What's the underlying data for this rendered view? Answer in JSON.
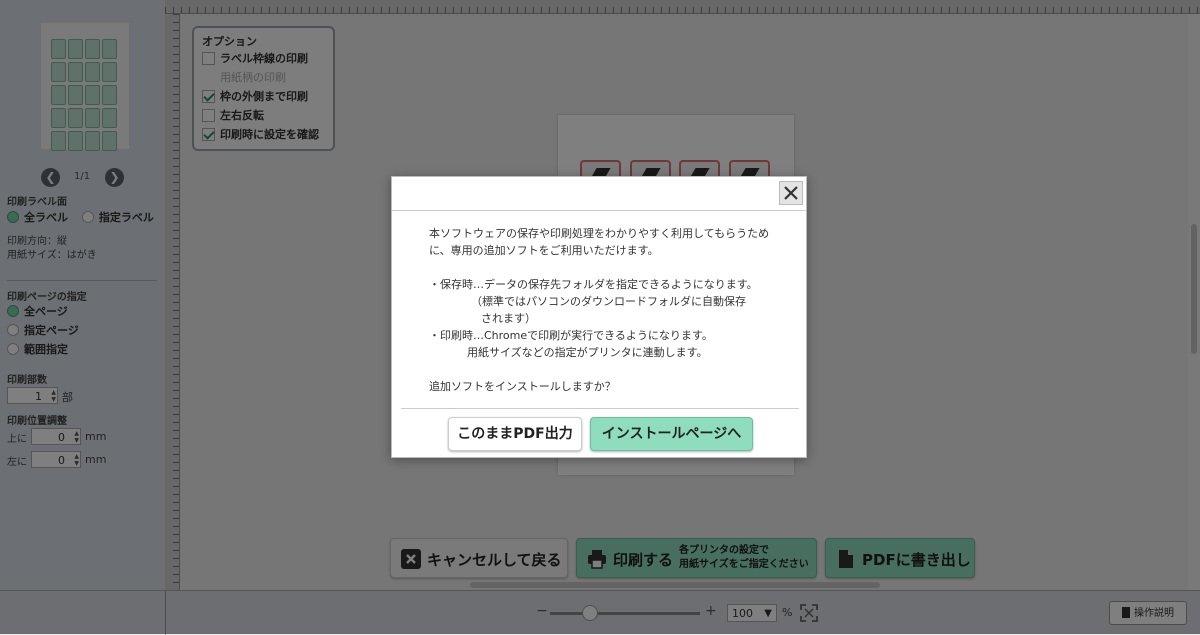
{
  "sidebar": {
    "page_indicator": "1/1",
    "print_label_side_title": "印刷ラベル面",
    "label_side_options": [
      "全ラベル",
      "指定ラベル"
    ],
    "orientation": "印刷方向：縦",
    "paper_size": "用紙サイズ：はがき",
    "page_spec_title": "印刷ページの指定",
    "page_options": [
      "全ページ",
      "指定ページ",
      "範囲指定"
    ],
    "copies_title": "印刷部数",
    "copies_value": "1",
    "copies_unit": "部",
    "offset_title": "印刷位置調整",
    "offset_top_label": "上に",
    "offset_top_value": "0",
    "offset_left_label": "左に",
    "offset_left_value": "0",
    "offset_unit": "mm"
  },
  "options": {
    "title": "オプション",
    "items": [
      {
        "label": "ラベル枠線の印刷",
        "checked": false
      },
      {
        "label": "用紙柄の印刷",
        "checked": false
      },
      {
        "label": "枠の外側まで印刷",
        "checked": true
      },
      {
        "label": "左右反転",
        "checked": false
      },
      {
        "label": "印刷時に設定を確認",
        "checked": true
      }
    ]
  },
  "actions": {
    "cancel_label": "キャンセルして戻る",
    "print_label": "印刷する",
    "print_note_1": "各プリンタの設定で",
    "print_note_2": "用紙サイズをご指定ください",
    "pdf_label": "PDFに書き出し"
  },
  "zoom": {
    "minus": "−",
    "plus": "+",
    "value": "100",
    "unit": "%"
  },
  "help_label": "操作説明",
  "dialog": {
    "lines": [
      "本ソフトウェアの保存や印刷処理をわかりやすく利用してもらうため",
      "に、専用の追加ソフトをご利用いただけます。",
      "・保存時…データの保存先フォルダを指定できるようになります。",
      "（標準ではパソコンのダウンロードフォルダに自動保存",
      "されます）",
      "・印刷時…Chromeで印刷が実行できるようになります。",
      "用紙サイズなどの指定がプリンタに連動します。",
      "追加ソフトをインストールしますか？"
    ],
    "pdf_button": "このままPDF出力",
    "install_button": "インストールページへ"
  },
  "colors": {
    "accent_green": "#8fdcbf",
    "sidebar_bg": "#d9e0e8",
    "overlay": "rgba(0,0,0,0.5)"
  }
}
